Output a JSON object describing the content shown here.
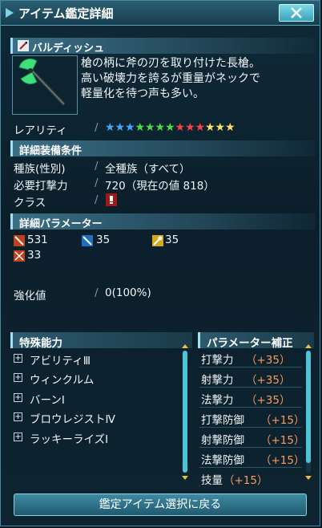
{
  "window": {
    "title": "アイテム鑑定詳細"
  },
  "item": {
    "name": "バルディッシュ",
    "description": [
      "槍の柄に斧の刃を取り付けた長槍。",
      "高い破壊力を誇るが重量がネックで",
      "軽量化を待つ声も多い。"
    ]
  },
  "rarity": {
    "label": "レアリティ",
    "stars": 13,
    "star_colors": [
      "#3fa9ff",
      "#3fa9ff",
      "#3fa9ff",
      "#46e046",
      "#46e046",
      "#46e046",
      "#46e046",
      "#ff4040",
      "#ff4040",
      "#ff4040",
      "#ffe066",
      "#ffe066",
      "#ffe066"
    ]
  },
  "equip": {
    "header": "詳細装備条件",
    "rows": [
      {
        "label": "種族(性別)",
        "value": "全種族（すべて）"
      },
      {
        "label": "必要打撃力",
        "value": "720（現在の値 818）"
      },
      {
        "label": "クラス",
        "value": ""
      }
    ]
  },
  "params": {
    "header": "詳細パラメーター",
    "stats": [
      {
        "icon": "sword-icon",
        "value": "531"
      },
      {
        "icon": "gun-icon",
        "value": "35"
      },
      {
        "icon": "wand-icon",
        "value": "35"
      },
      {
        "icon": "defense-icon",
        "value": "33"
      }
    ]
  },
  "enhance": {
    "label": "強化値",
    "value": "0(100%)"
  },
  "abilities": {
    "header": "特殊能力",
    "items": [
      "アビリティⅢ",
      "ウィンクルム",
      "バーンⅠ",
      "ブロウレジストⅣ",
      "ラッキーライズⅠ"
    ]
  },
  "param_bonus": {
    "header": "パラメーター補正",
    "items": [
      {
        "name": "打撃力",
        "value": "（+35）"
      },
      {
        "name": "射撃力",
        "value": "（+35）"
      },
      {
        "name": "法撃力",
        "value": "（+35）"
      },
      {
        "name": "打撃防御",
        "value": "（+15）"
      },
      {
        "name": "射撃防御",
        "value": "（+15）"
      },
      {
        "name": "法撃防御",
        "value": "（+15）"
      },
      {
        "name": "技量",
        "value": "（+15）"
      }
    ]
  },
  "footer": {
    "back_label": "鑑定アイテム選択に戻る"
  }
}
